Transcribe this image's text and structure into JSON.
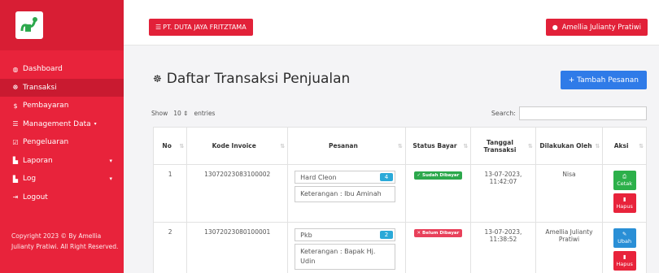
{
  "sidebar": {
    "items": [
      {
        "label": "Dashboard",
        "icon": "◍",
        "caret": false
      },
      {
        "label": "Transaksi",
        "icon": "☸",
        "caret": false
      },
      {
        "label": "Pembayaran",
        "icon": "$",
        "caret": false
      },
      {
        "label": "Management Data",
        "icon": "☰",
        "caret": true
      },
      {
        "label": "Pengeluaran",
        "icon": "☑",
        "caret": false
      },
      {
        "label": "Laporan",
        "icon": "▙",
        "caret": true
      },
      {
        "label": "Log",
        "icon": "▙",
        "caret": true
      },
      {
        "label": "Logout",
        "icon": "⇥",
        "caret": false
      }
    ],
    "copyright": "Copyright 2023 © By Amellia Julianty Pratiwi. All Right Reserved."
  },
  "topbar": {
    "company": "PT. DUTA JAYA FRITZTAMA",
    "user": "Amellia Julianty Pratiwi"
  },
  "main": {
    "title": "Daftar Transaksi Penjualan",
    "add_button": "+ Tambah Pesanan",
    "show_label": "Show",
    "show_value": "10",
    "entries_label": "entries",
    "search_label": "Search:",
    "columns": [
      "No",
      "Kode Invoice",
      "Pesanan",
      "Status Bayar",
      "Tanggal Transaksi",
      "Dilakukan Oleh",
      "Aksi"
    ],
    "rows": [
      {
        "no": "1",
        "invoice": "13072023083100002",
        "item": "Hard Cleon",
        "qty": "4",
        "keterangan": "Keterangan : Ibu Aminah",
        "status": "✓ Sudah Dibayar",
        "tanggal": "13-07-2023, 11:42:07",
        "oleh": "Nisa",
        "actions": [
          "Cetak",
          "Hapus"
        ]
      },
      {
        "no": "2",
        "invoice": "13072023080100001",
        "item": "Pkb",
        "qty": "2",
        "keterangan": "Keterangan : Bapak Hj. Udin",
        "status": "✕ Belum Dibayar",
        "tanggal": "13-07-2023, 11:38:52",
        "oleh": "Amellia Julianty Pratiwi",
        "actions": [
          "Ubah",
          "Hapus"
        ]
      }
    ]
  },
  "colors": {
    "sidebar": "#e8233b",
    "primary": "#2f7be8",
    "success": "#2cb04a",
    "info": "#2aa9d8"
  }
}
